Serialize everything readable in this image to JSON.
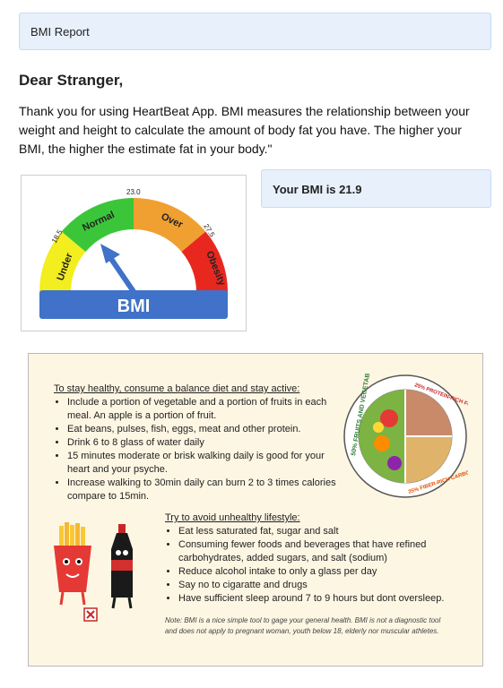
{
  "header": {
    "title": "BMI Report"
  },
  "greeting": "Dear Stranger,",
  "intro": "Thank you for using HeartBeat App. BMI measures the relationship between your weight and height to calculate the amount of body fat you have. The higher your BMI, the higher the estimate fat in your body.\"",
  "result": {
    "text": "Your BMI is 21.9",
    "value": 21.9
  },
  "gauge": {
    "label": "BMI",
    "ticks": [
      "18.5",
      "23.0",
      "27.5"
    ],
    "zones": [
      {
        "label": "Under",
        "color": "#f2ee1f"
      },
      {
        "label": "Normal",
        "color": "#3bc63a"
      },
      {
        "label": "Over",
        "color": "#f0a030"
      },
      {
        "label": "Obesity",
        "color": "#e8281f"
      }
    ],
    "base_color": "#3f72c8",
    "needle_color": "#3f72c8"
  },
  "healthy": {
    "title": "To stay healthy, consume a balance diet and stay active:",
    "items": [
      "Include a portion of vegetable and a portion of fruits in each meal. An apple is a portion of fruit.",
      "Eat beans, pulses, fish, eggs, meat and other protein.",
      "Drink 6 to 8 glass of water daily",
      "15 minutes  moderate or brisk walking daily is good for your heart and your psyche.",
      "Increase walking to 30min daily can burn 2 to 3 times calories compare to 15min."
    ]
  },
  "avoid": {
    "title": "Try to avoid unhealthy lifestyle:",
    "items": [
      "Eat less saturated fat, sugar and salt",
      "Consuming fewer foods and beverages that have refined carbohydrates, added sugars, and salt (sodium)",
      "Reduce alcohol intake to only a glass per day",
      "Say no to cigaratte and drugs",
      "Have sufficient sleep around 7 to 9 hours but dont oversleep."
    ]
  },
  "note": "Note: BMI is a nice simple tool to gage your general health. BMI is not a diagnostic tool and does not apply to pregnant woman, youth below 18, elderly nor muscular athletes.",
  "plate": {
    "labels": [
      "50% FRUITS AND VEGETABLES",
      "25% PROTEIN-RICH FOODS",
      "25% FIBER-RICH CARBOHYDRATES"
    ]
  }
}
